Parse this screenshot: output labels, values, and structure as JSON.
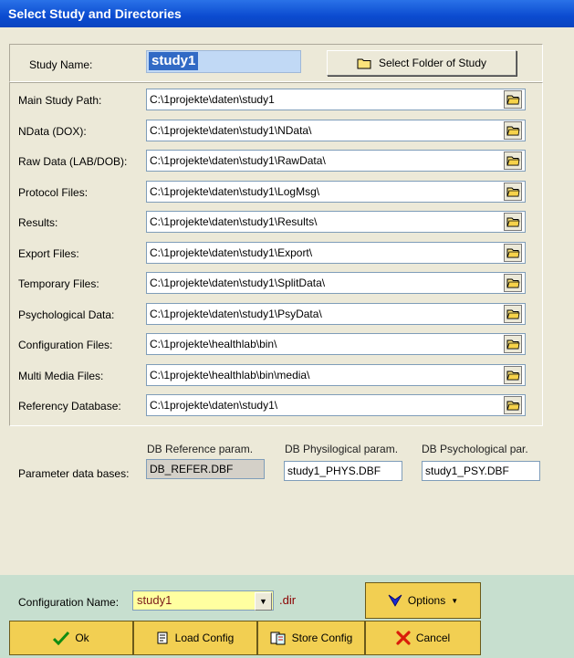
{
  "window": {
    "title": "Select Study and Directories"
  },
  "study": {
    "name_label": "Study Name:",
    "name_value": "study1",
    "select_folder_label": "Select Folder of Study"
  },
  "paths": [
    {
      "label": "Main Study Path:",
      "value": "C:\\1projekte\\daten\\study1"
    },
    {
      "label": "NData (DOX):",
      "value": "C:\\1projekte\\daten\\study1\\NData\\"
    },
    {
      "label": "Raw Data (LAB/DOB):",
      "value": "C:\\1projekte\\daten\\study1\\RawData\\"
    },
    {
      "label": "Protocol Files:",
      "value": "C:\\1projekte\\daten\\study1\\LogMsg\\"
    },
    {
      "label": "Results:",
      "value": "C:\\1projekte\\daten\\study1\\Results\\"
    },
    {
      "label": "Export Files:",
      "value": "C:\\1projekte\\daten\\study1\\Export\\"
    },
    {
      "label": "Temporary Files:",
      "value": "C:\\1projekte\\daten\\study1\\SplitData\\"
    },
    {
      "label": "Psychological Data:",
      "value": "C:\\1projekte\\daten\\study1\\PsyData\\"
    },
    {
      "label": "Configuration Files:",
      "value": "C:\\1projekte\\healthlab\\bin\\"
    },
    {
      "label": "Multi Media Files:",
      "value": "C:\\1projekte\\healthlab\\bin\\media\\"
    },
    {
      "label": "Referency Database:",
      "value": "C:\\1projekte\\daten\\study1\\"
    }
  ],
  "databases": {
    "label": "Parameter data bases:",
    "ref_title": "DB Reference param.",
    "ref_value": "DB_REFER.DBF",
    "phys_title": "DB Physilogical param.",
    "phys_value": "study1_PHYS.DBF",
    "psy_title": "DB Psychological par.",
    "psy_value": "study1_PSY.DBF"
  },
  "config": {
    "name_label": "Configuration Name:",
    "name_value": "study1",
    "ext": ".dir",
    "options_label": "Options"
  },
  "buttons": {
    "ok": "Ok",
    "load": "Load Config",
    "store": "Store Config",
    "cancel": "Cancel"
  },
  "colors": {
    "title_bar": "#0b4bd0",
    "bottom_bar": "#c7dfcf",
    "action_button": "#f2cf52",
    "config_field": "#ffffa0"
  },
  "icons": [
    "folder-icon",
    "checkmark-icon",
    "load-config-icon",
    "store-config-icon",
    "cancel-x-icon",
    "options-arrow-icon"
  ]
}
